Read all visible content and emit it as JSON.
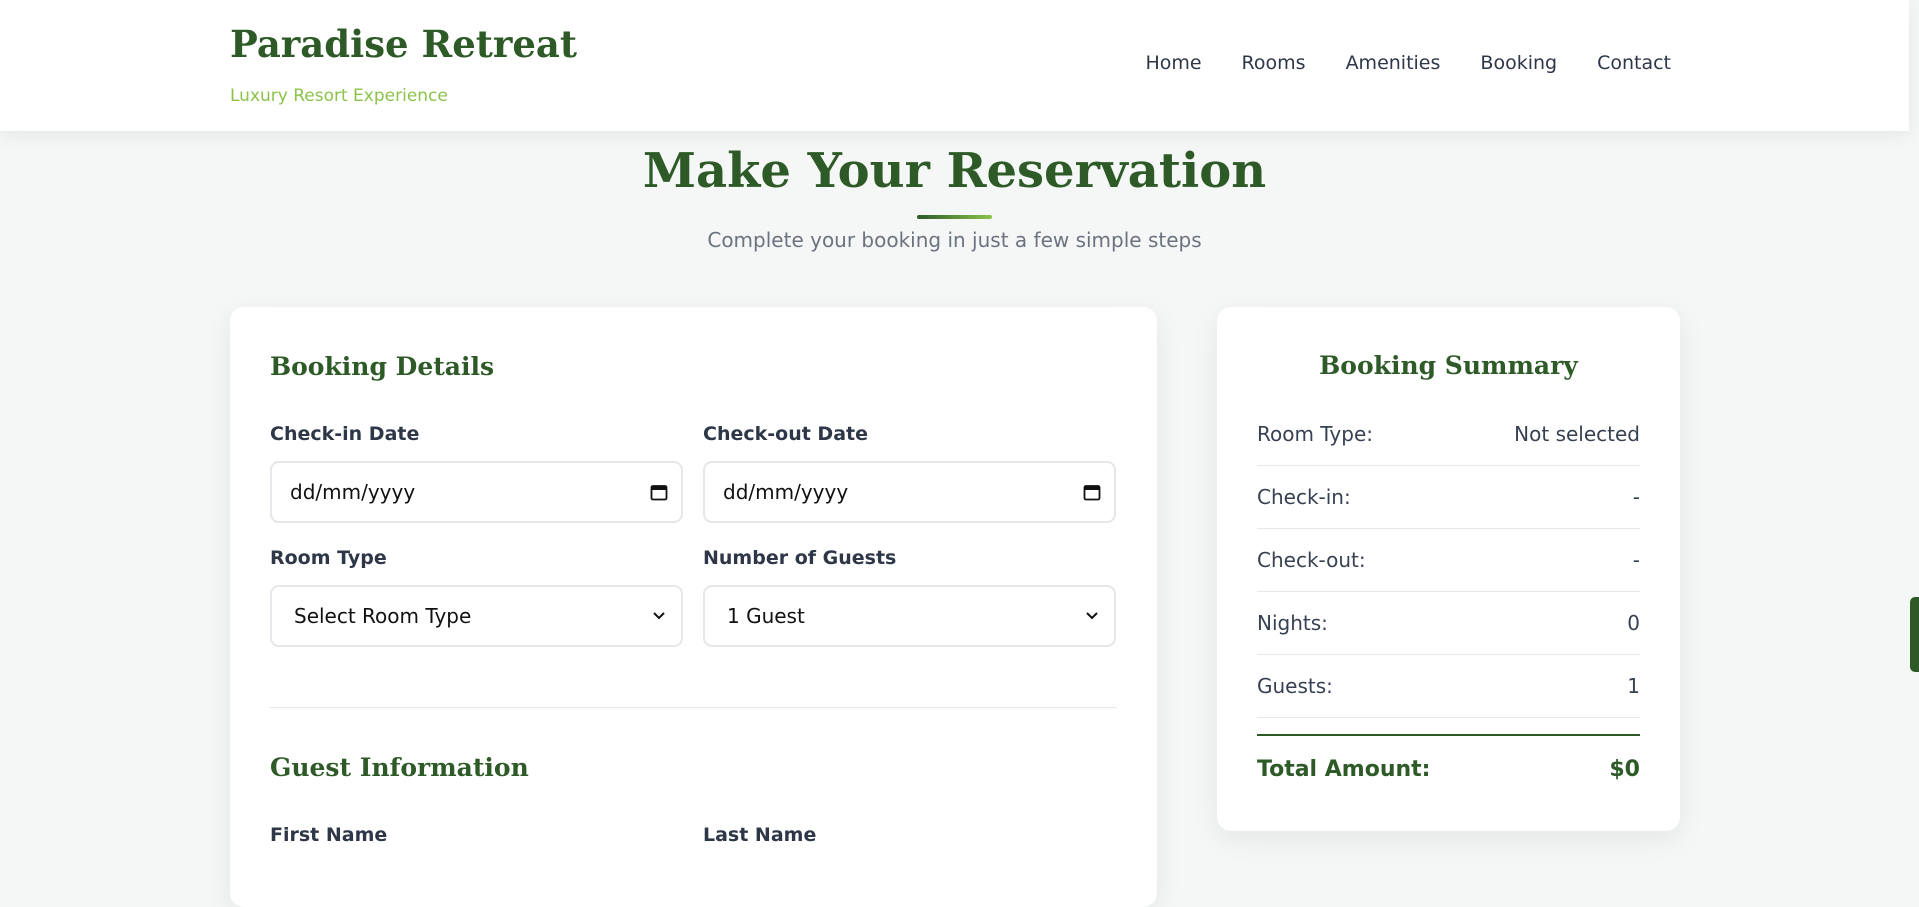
{
  "header": {
    "brand_title": "Paradise Retreat",
    "brand_tagline": "Luxury Resort Experience",
    "nav": [
      "Home",
      "Rooms",
      "Amenities",
      "Booking",
      "Contact"
    ]
  },
  "page": {
    "title": "Make Your Reservation",
    "subtitle": "Complete your booking in just a few simple steps"
  },
  "booking_details": {
    "heading": "Booking Details",
    "checkin_label": "Check-in Date",
    "checkin_value": "dd/mm/yyyy",
    "checkout_label": "Check-out Date",
    "checkout_value": "dd/mm/yyyy",
    "room_type_label": "Room Type",
    "room_type_value": "Select Room Type",
    "guests_label": "Number of Guests",
    "guests_value": "1 Guest"
  },
  "guest_information": {
    "heading": "Guest Information",
    "first_name_label": "First Name",
    "last_name_label": "Last Name"
  },
  "summary": {
    "title": "Booking Summary",
    "rows": [
      {
        "label": "Room Type:",
        "value": "Not selected"
      },
      {
        "label": "Check-in:",
        "value": "-"
      },
      {
        "label": "Check-out:",
        "value": "-"
      },
      {
        "label": "Nights:",
        "value": "0"
      },
      {
        "label": "Guests:",
        "value": "1"
      }
    ],
    "total_label": "Total Amount:",
    "total_value": "$0"
  },
  "colors": {
    "brand_green": "#2d5a27",
    "accent_light_green": "#8bc34a",
    "page_background": "#f5f7f6"
  },
  "icons": {
    "date_picker": "calendar-icon",
    "select_caret": "chevron-down-icon"
  }
}
